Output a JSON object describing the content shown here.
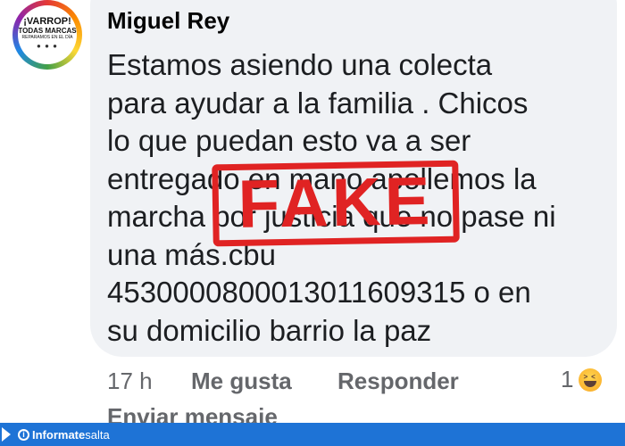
{
  "avatar": {
    "line1": "¡VARROP!",
    "line2": "TODAS MARCAS",
    "line3": "REPARAMOS EN EL DÍA",
    "line4": "",
    "dots": "● ● ●"
  },
  "comment": {
    "author": "Miguel Rey",
    "text": "Estamos asiendo una colecta\npara ayudar a la familia . Chicos\nlo que puedan esto va a ser\nentregado en mano apollemos la\nmarcha por justicia que no pase ni\nuna más.cbu\n4530000800013011609315 o en\nsu domicilio barrio la paz",
    "stamp": "FAKE"
  },
  "actions": {
    "time": "17 h",
    "like": "Me gusta",
    "reply": "Responder",
    "reaction_count": "1",
    "reaction_icon": "laughing-emoji-icon",
    "send_message": "Enviar mensaje"
  },
  "brand": {
    "logo_letter": "i",
    "name_bold": "Informate",
    "name_light": "salta",
    "color": "#1e73d6"
  },
  "colors": {
    "bubble": "#f0f2f5",
    "stamp": "#e02323",
    "meta_text": "#65676b"
  }
}
